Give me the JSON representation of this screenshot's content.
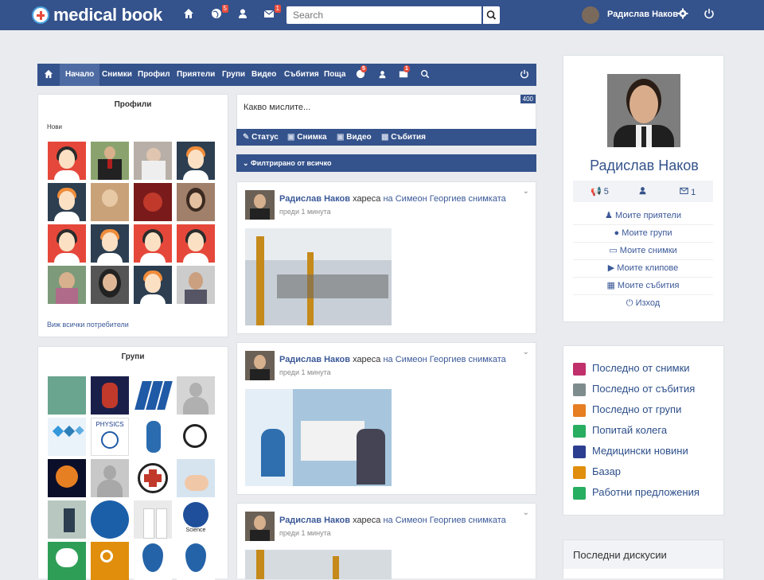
{
  "app": {
    "title": "medical book"
  },
  "topbar": {
    "search_placeholder": "Search",
    "user_name": "Радислав Наков",
    "badge_globe": "5",
    "badge_messages": "1"
  },
  "nav": {
    "items": [
      "Начало",
      "Снимки",
      "Профил",
      "Приятели",
      "Групи",
      "Видео",
      "Събития",
      "Поща"
    ],
    "badge_globe": "5",
    "badge_messages": "1"
  },
  "profiles": {
    "title": "Профили",
    "filter_label": "Нови",
    "view_all": "Виж всички потребители"
  },
  "groups": {
    "title": "Групи"
  },
  "composer": {
    "placeholder": "Какво мислите...",
    "counter": "400",
    "tabs": [
      "Статус",
      "Снимка",
      "Видео",
      "Събития"
    ],
    "filter_prefix": "Филтрирано от ",
    "filter_value": "всичко"
  },
  "posts": [
    {
      "author": "Радислав Наков",
      "verb": "хареса",
      "target": "на Симеон Георгиев снимката",
      "time": "преди 1 минута"
    },
    {
      "author": "Радислав Наков",
      "verb": "хареса",
      "target": "на Симеон Георгиев снимката",
      "time": "преди 1 минута"
    },
    {
      "author": "Радислав Наков",
      "verb": "хареса",
      "target": "на Симеон Георгиев снимката",
      "time": "преди 1 минута"
    }
  ],
  "profile_card": {
    "name": "Радислав Наков",
    "stat_posts": "5",
    "stat_messages": "1",
    "menu": [
      "Моите приятели",
      "Моите групи",
      "Моите снимки",
      "Моите клипове",
      "Моите събития",
      "Изход"
    ]
  },
  "recent": {
    "items": [
      {
        "label": "Последно от снимки",
        "color": "#c0306a"
      },
      {
        "label": "Последно от събития",
        "color": "#7f8c8d"
      },
      {
        "label": "Последно от групи",
        "color": "#e67e22"
      },
      {
        "label": "Попитай колега",
        "color": "#27ae60"
      },
      {
        "label": "Медицински новини",
        "color": "#2c3e8f"
      },
      {
        "label": "Базар",
        "color": "#e08e0b"
      },
      {
        "label": "Работни предложения",
        "color": "#27ae60"
      }
    ]
  },
  "discussions": {
    "title": "Последни дискусии"
  },
  "colors": {
    "brand": "#34528b",
    "link": "#3b5998",
    "badge": "#e74c3c"
  }
}
